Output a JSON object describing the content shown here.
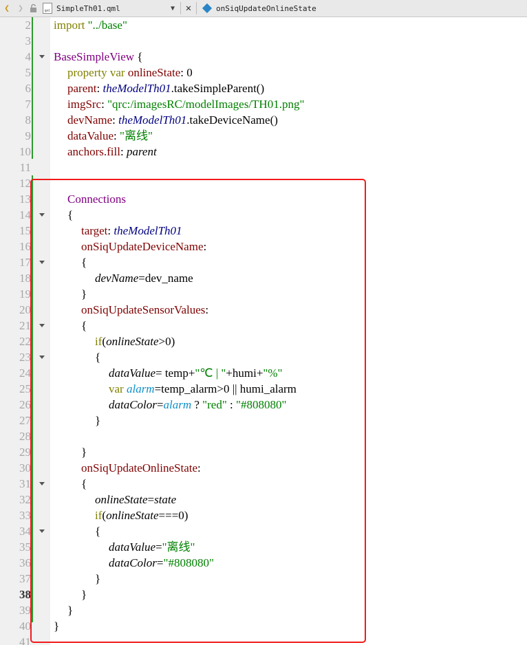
{
  "toolbar": {
    "file_name": "SimpleTh01.qml",
    "file_icon_text": "qml",
    "symbol_name": "onSiqUpdateOnlineState"
  },
  "colors": {
    "keyword": "#808000",
    "type": "#800080",
    "property": "#800000",
    "string": "#008000",
    "instance": "#000080",
    "local_var": "#0e8fc9",
    "highlight_box": "#f21a1a",
    "change_bar": "#2c9a2c"
  },
  "lines": [
    {
      "n": "2",
      "indent": 0,
      "fold": false,
      "tokens": [
        {
          "c": "kw",
          "t": "import "
        },
        {
          "c": "str",
          "t": "\"../base\""
        }
      ]
    },
    {
      "n": "3",
      "indent": 0,
      "fold": false,
      "tokens": []
    },
    {
      "n": "4",
      "indent": 0,
      "fold": true,
      "tokens": [
        {
          "c": "type",
          "t": "BaseSimpleView"
        },
        {
          "c": "",
          "t": " {"
        }
      ]
    },
    {
      "n": "5",
      "indent": 1,
      "fold": false,
      "tokens": [
        {
          "c": "kw",
          "t": "property var "
        },
        {
          "c": "prop",
          "t": "onlineState"
        },
        {
          "c": "",
          "t": ": 0"
        }
      ]
    },
    {
      "n": "6",
      "indent": 1,
      "fold": false,
      "tokens": [
        {
          "c": "prop",
          "t": "parent"
        },
        {
          "c": "",
          "t": ": "
        },
        {
          "c": "inst",
          "t": "theModelTh01"
        },
        {
          "c": "",
          "t": ".takeSimpleParent()"
        }
      ]
    },
    {
      "n": "7",
      "indent": 1,
      "fold": false,
      "tokens": [
        {
          "c": "prop",
          "t": "imgSrc"
        },
        {
          "c": "",
          "t": ": "
        },
        {
          "c": "str",
          "t": "\"qrc:/imagesRC/modelImages/TH01.png\""
        }
      ]
    },
    {
      "n": "8",
      "indent": 1,
      "fold": false,
      "tokens": [
        {
          "c": "prop",
          "t": "devName"
        },
        {
          "c": "",
          "t": ": "
        },
        {
          "c": "inst",
          "t": "theModelTh01"
        },
        {
          "c": "",
          "t": ".takeDeviceName()"
        }
      ]
    },
    {
      "n": "9",
      "indent": 1,
      "fold": false,
      "tokens": [
        {
          "c": "prop",
          "t": "dataValue"
        },
        {
          "c": "",
          "t": ": "
        },
        {
          "c": "str",
          "t": "\"离线\""
        }
      ]
    },
    {
      "n": "10",
      "indent": 1,
      "fold": false,
      "tokens": [
        {
          "c": "prop",
          "t": "anchors.fill"
        },
        {
          "c": "",
          "t": ": "
        },
        {
          "c": "ital",
          "t": "parent"
        }
      ]
    },
    {
      "n": "11",
      "indent": 0,
      "fold": false,
      "tokens": []
    },
    {
      "n": "12",
      "indent": 0,
      "fold": false,
      "tokens": []
    },
    {
      "n": "13",
      "indent": 1,
      "fold": false,
      "tokens": [
        {
          "c": "type",
          "t": "Connections"
        }
      ]
    },
    {
      "n": "14",
      "indent": 1,
      "fold": true,
      "tokens": [
        {
          "c": "",
          "t": "{"
        }
      ]
    },
    {
      "n": "15",
      "indent": 2,
      "fold": false,
      "tokens": [
        {
          "c": "prop",
          "t": "target"
        },
        {
          "c": "",
          "t": ": "
        },
        {
          "c": "inst",
          "t": "theModelTh01"
        }
      ]
    },
    {
      "n": "16",
      "indent": 2,
      "fold": false,
      "tokens": [
        {
          "c": "prop",
          "t": "onSiqUpdateDeviceName"
        },
        {
          "c": "",
          "t": ":"
        }
      ]
    },
    {
      "n": "17",
      "indent": 2,
      "fold": true,
      "tokens": [
        {
          "c": "",
          "t": "{"
        }
      ]
    },
    {
      "n": "18",
      "indent": 3,
      "fold": false,
      "tokens": [
        {
          "c": "ital",
          "t": "devName"
        },
        {
          "c": "",
          "t": "=dev_name"
        }
      ]
    },
    {
      "n": "19",
      "indent": 2,
      "fold": false,
      "tokens": [
        {
          "c": "",
          "t": "}"
        }
      ]
    },
    {
      "n": "20",
      "indent": 2,
      "fold": false,
      "tokens": [
        {
          "c": "prop",
          "t": "onSiqUpdateSensorValues"
        },
        {
          "c": "",
          "t": ":"
        }
      ]
    },
    {
      "n": "21",
      "indent": 2,
      "fold": true,
      "tokens": [
        {
          "c": "",
          "t": "{"
        }
      ]
    },
    {
      "n": "22",
      "indent": 3,
      "fold": false,
      "tokens": [
        {
          "c": "kw",
          "t": "if"
        },
        {
          "c": "",
          "t": "("
        },
        {
          "c": "ital",
          "t": "onlineState"
        },
        {
          "c": "",
          "t": ">0)"
        }
      ]
    },
    {
      "n": "23",
      "indent": 3,
      "fold": true,
      "tokens": [
        {
          "c": "",
          "t": "{"
        }
      ]
    },
    {
      "n": "24",
      "indent": 4,
      "fold": false,
      "tokens": [
        {
          "c": "ital",
          "t": "dataValue"
        },
        {
          "c": "",
          "t": "= temp+"
        },
        {
          "c": "str",
          "t": "\"℃ | \""
        },
        {
          "c": "",
          "t": "+humi+"
        },
        {
          "c": "str",
          "t": "\"%\""
        }
      ]
    },
    {
      "n": "25",
      "indent": 4,
      "fold": false,
      "tokens": [
        {
          "c": "kw",
          "t": "var "
        },
        {
          "c": "var",
          "t": "alarm"
        },
        {
          "c": "",
          "t": "=temp_alarm>0 || humi_alarm"
        }
      ]
    },
    {
      "n": "26",
      "indent": 4,
      "fold": false,
      "tokens": [
        {
          "c": "ital",
          "t": "dataColor"
        },
        {
          "c": "",
          "t": "="
        },
        {
          "c": "var",
          "t": "alarm"
        },
        {
          "c": "",
          "t": " ? "
        },
        {
          "c": "str",
          "t": "\"red\""
        },
        {
          "c": "",
          "t": " : "
        },
        {
          "c": "str",
          "t": "\"#808080\""
        }
      ]
    },
    {
      "n": "27",
      "indent": 3,
      "fold": false,
      "tokens": [
        {
          "c": "",
          "t": "}"
        }
      ]
    },
    {
      "n": "28",
      "indent": 0,
      "fold": false,
      "tokens": []
    },
    {
      "n": "29",
      "indent": 2,
      "fold": false,
      "tokens": [
        {
          "c": "",
          "t": "}"
        }
      ]
    },
    {
      "n": "30",
      "indent": 2,
      "fold": false,
      "tokens": [
        {
          "c": "prop",
          "t": "onSiqUpdateOnlineState"
        },
        {
          "c": "",
          "t": ":"
        }
      ]
    },
    {
      "n": "31",
      "indent": 2,
      "fold": true,
      "tokens": [
        {
          "c": "",
          "t": "{"
        }
      ]
    },
    {
      "n": "32",
      "indent": 3,
      "fold": false,
      "tokens": [
        {
          "c": "ital",
          "t": "onlineState"
        },
        {
          "c": "",
          "t": "="
        },
        {
          "c": "ital",
          "t": "state"
        }
      ]
    },
    {
      "n": "33",
      "indent": 3,
      "fold": false,
      "tokens": [
        {
          "c": "kw",
          "t": "if"
        },
        {
          "c": "",
          "t": "("
        },
        {
          "c": "ital",
          "t": "onlineState"
        },
        {
          "c": "",
          "t": "===0)"
        }
      ]
    },
    {
      "n": "34",
      "indent": 3,
      "fold": true,
      "tokens": [
        {
          "c": "",
          "t": "{"
        }
      ]
    },
    {
      "n": "35",
      "indent": 4,
      "fold": false,
      "tokens": [
        {
          "c": "ital",
          "t": "dataValue"
        },
        {
          "c": "",
          "t": "="
        },
        {
          "c": "str",
          "t": "\"离线\""
        }
      ]
    },
    {
      "n": "36",
      "indent": 4,
      "fold": false,
      "tokens": [
        {
          "c": "ital",
          "t": "dataColor"
        },
        {
          "c": "",
          "t": "="
        },
        {
          "c": "str",
          "t": "\"#808080\""
        }
      ]
    },
    {
      "n": "37",
      "indent": 3,
      "fold": false,
      "tokens": [
        {
          "c": "",
          "t": "}"
        }
      ]
    },
    {
      "n": "38",
      "indent": 2,
      "fold": false,
      "current": true,
      "tokens": [
        {
          "c": "",
          "t": "}"
        }
      ]
    },
    {
      "n": "39",
      "indent": 1,
      "fold": false,
      "tokens": [
        {
          "c": "",
          "t": "}"
        }
      ]
    },
    {
      "n": "40",
      "indent": 0,
      "fold": false,
      "tokens": [
        {
          "c": "",
          "t": "}"
        }
      ]
    },
    {
      "n": "41",
      "indent": 0,
      "fold": false,
      "tokens": []
    }
  ]
}
